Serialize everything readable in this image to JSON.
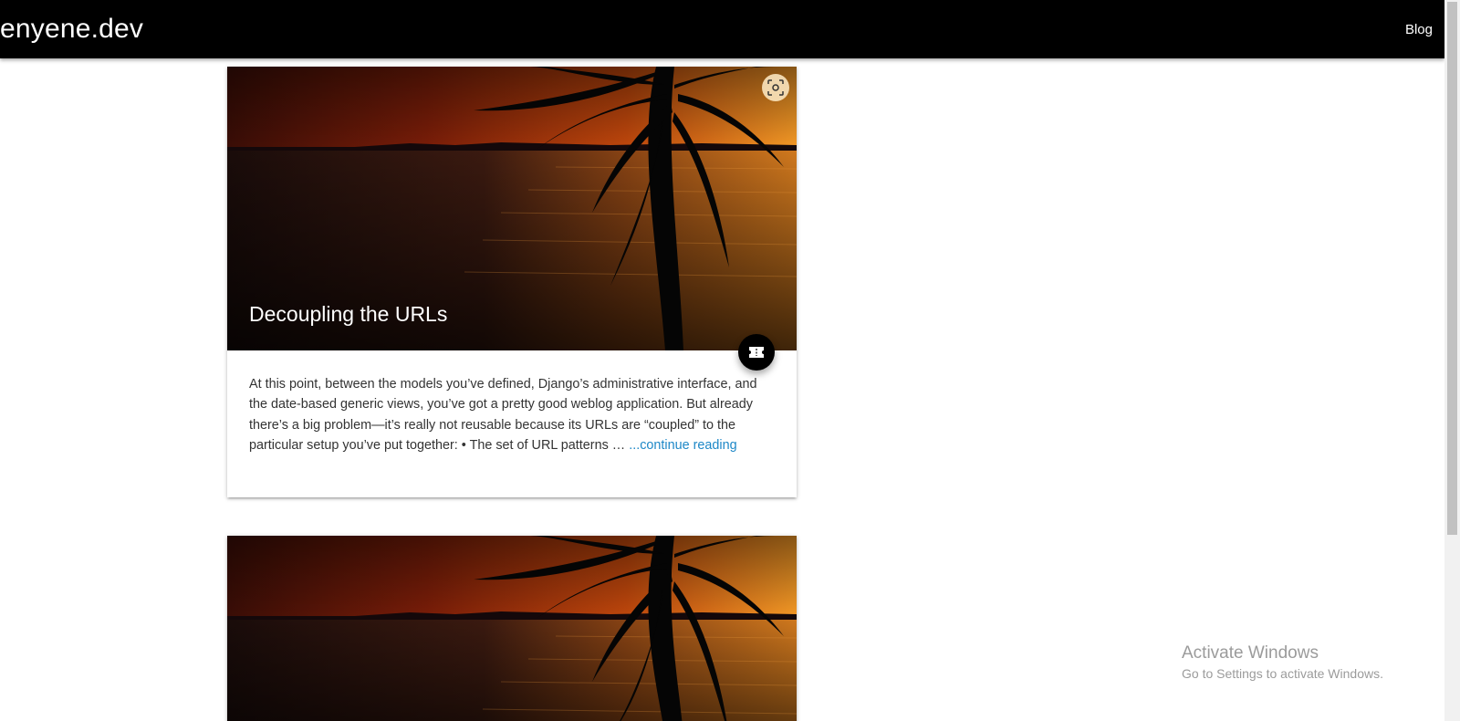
{
  "navbar": {
    "brand": "enyene.dev",
    "links": [
      {
        "label": "Blog"
      }
    ]
  },
  "posts": [
    {
      "title": "Decoupling the URLs",
      "excerpt": "At this point, between the models you’ve defined, Django’s administrative interface, and the date-based generic views, you’ve got a pretty good weblog application. But already there’s a big problem—it’s really not reusable because its URLs are “coupled” to the particular setup you’ve put together: • The set of URL patterns … ",
      "continue_label": "...continue reading",
      "image_icon": "lens-scan-icon",
      "fab_icon": "ticket-icon"
    },
    {
      "title": "",
      "image_icon": "lens-scan-icon"
    }
  ],
  "watermark": {
    "title": "Activate Windows",
    "subtitle": "Go to Settings to activate Windows."
  },
  "colors": {
    "navbar": "#000000",
    "link": "#1e88c7",
    "text": "#333333",
    "sunset_orange": "#f0901e"
  }
}
